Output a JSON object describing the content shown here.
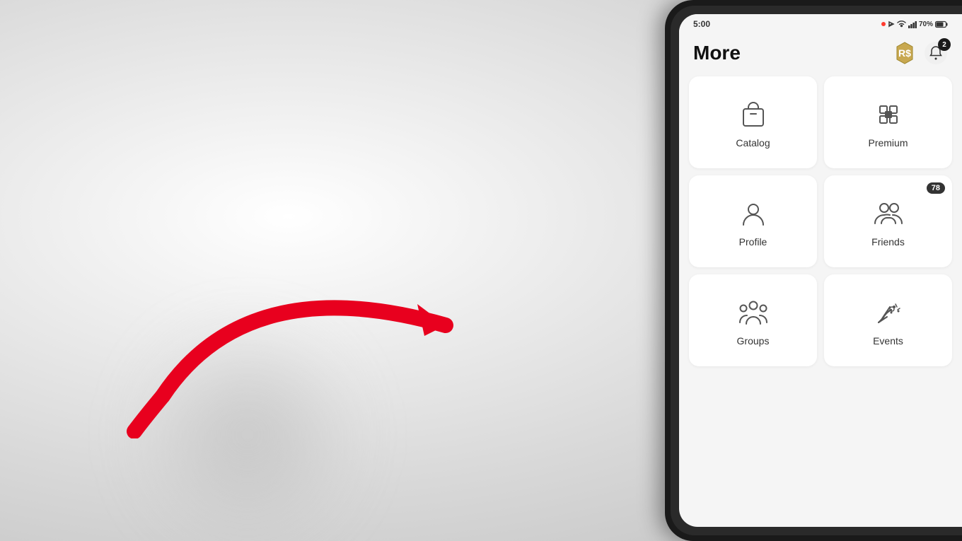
{
  "background": {
    "color": "#e0e0e0"
  },
  "status_bar": {
    "time": "5:00",
    "battery": "70%",
    "signal": "4G"
  },
  "header": {
    "title": "More",
    "robux_icon": "robux-icon",
    "notification_badge": "2"
  },
  "menu_items": [
    {
      "id": "catalog",
      "label": "Catalog",
      "icon": "catalog-icon",
      "badge": null
    },
    {
      "id": "premium",
      "label": "Premium",
      "icon": "premium-icon",
      "badge": null
    },
    {
      "id": "profile",
      "label": "Profile",
      "icon": "profile-icon",
      "badge": null
    },
    {
      "id": "friends",
      "label": "Friends",
      "icon": "friends-icon",
      "badge": "78"
    },
    {
      "id": "groups",
      "label": "Groups",
      "icon": "groups-icon",
      "badge": null
    },
    {
      "id": "events",
      "label": "Events",
      "icon": "events-icon",
      "badge": null
    }
  ],
  "arrow": {
    "color": "#e8001e"
  }
}
